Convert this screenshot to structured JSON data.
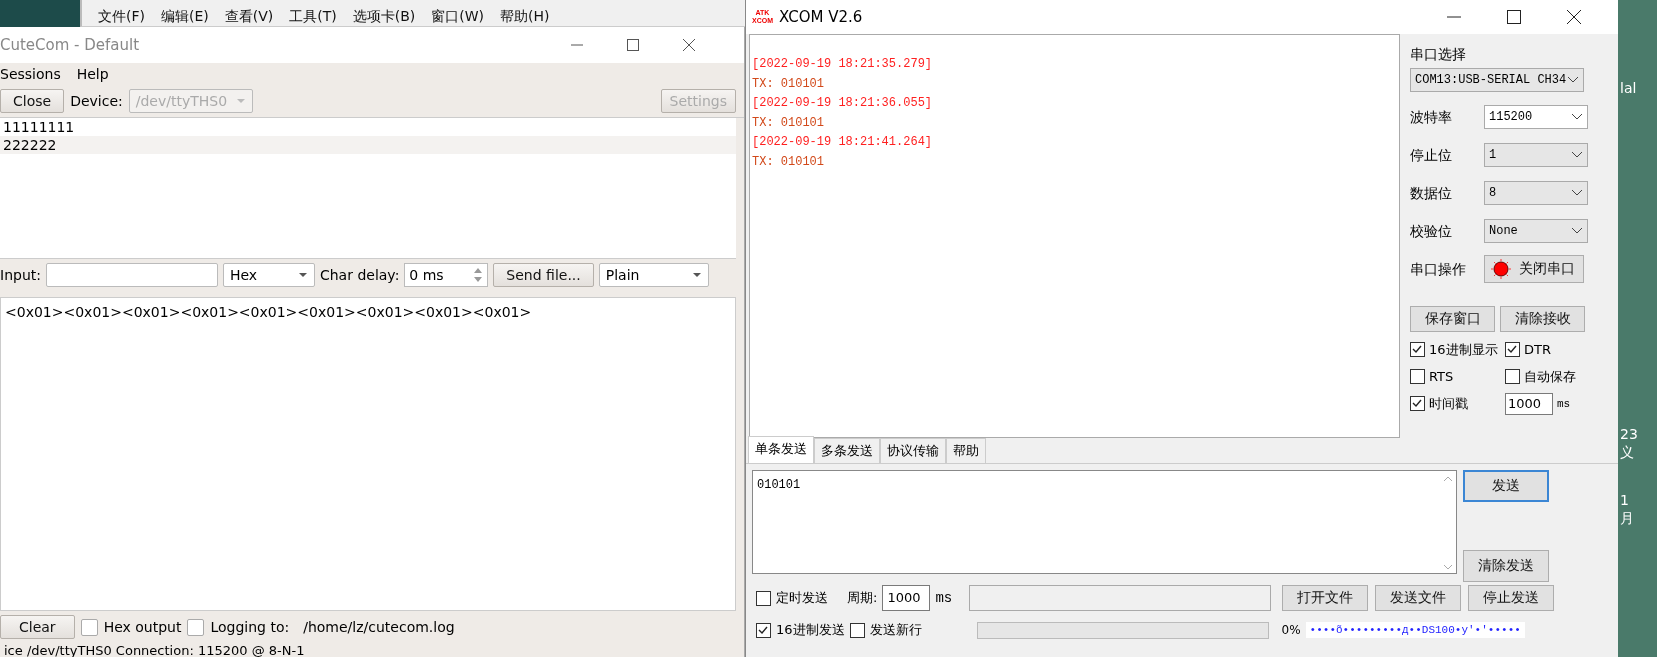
{
  "background_window": {
    "menu": [
      "文件(F)",
      "编辑(E)",
      "查看(V)",
      "工具(T)",
      "选项卡(B)",
      "窗口(W)",
      "帮助(H)"
    ]
  },
  "cutecom": {
    "title": "CuteCom - Default",
    "menu": [
      "Sessions",
      "Help"
    ],
    "close_button": "Close",
    "device_label": "Device:",
    "device": {
      "value": "/dev/ttyTHS0",
      "disabled": true
    },
    "settings_button": {
      "label": "Settings",
      "disabled": true
    },
    "history": [
      "11111111",
      "222222"
    ],
    "input_label": "Input:",
    "input_format": "Hex",
    "char_delay_label": "Char delay:",
    "char_delay": "0 ms",
    "send_file_button": "Send file...",
    "line_end": "Plain",
    "output": "<0x01><0x01><0x01><0x01><0x01><0x01><0x01><0x01><0x01>",
    "clear_button": "Clear",
    "hex_output": {
      "label": "Hex output",
      "checked": false
    },
    "logging": {
      "label": "Logging to:",
      "checked": false
    },
    "log_path": "/home/lz/cutecom.log",
    "status_bar": "ice /dev/ttyTHS0  Connection: 115200 @ 8-N-1"
  },
  "xcom": {
    "logo": [
      "ATK",
      "XCOM"
    ],
    "title": "XCOM V2.6",
    "receive": [
      {
        "kind": "timestamp",
        "text": "[2022-09-19 18:21:35.279]"
      },
      {
        "kind": "tx",
        "text": "TX: 010101"
      },
      {
        "kind": "timestamp",
        "text": "[2022-09-19 18:21:36.055]"
      },
      {
        "kind": "tx",
        "text": "TX: 010101"
      },
      {
        "kind": "timestamp",
        "text": "[2022-09-19 18:21:41.264]"
      },
      {
        "kind": "tx",
        "text": "TX: 010101"
      }
    ],
    "port_label": "串口选择",
    "port": "COM13:USB-SERIAL CH34",
    "settings": [
      {
        "label": "波特率",
        "value": "115200"
      },
      {
        "label": "停止位",
        "value": "1"
      },
      {
        "label": "数据位",
        "value": "8"
      },
      {
        "label": "校验位",
        "value": "None"
      }
    ],
    "operation_label": "串口操作",
    "operation_button": {
      "label": "关闭串口",
      "open": true
    },
    "save_window_button": "保存窗口",
    "clear_receive_button": "清除接收",
    "options": [
      {
        "label": "16进制显示",
        "checked": true
      },
      {
        "label": "DTR",
        "checked": true
      },
      {
        "label": "RTS",
        "checked": false
      },
      {
        "label": "自动保存",
        "checked": false
      },
      {
        "label": "时间戳",
        "checked": true
      }
    ],
    "timestamp_interval": "1000",
    "timestamp_unit": "ms",
    "tabs": [
      {
        "label": "单条发送",
        "selected": true
      },
      {
        "label": "多条发送",
        "selected": false
      },
      {
        "label": "协议传输",
        "selected": false
      },
      {
        "label": "帮助",
        "selected": false
      }
    ],
    "send_text": "010101",
    "send_button": "发送",
    "clear_send_button": "清除发送",
    "timed_send": {
      "label": "定时发送",
      "checked": false
    },
    "period_label": "周期:",
    "period": "1000",
    "period_unit": "ms",
    "open_file_button": "打开文件",
    "send_file_button": "发送文件",
    "stop_send_button": "停止发送",
    "hex_send": {
      "label": "16进制发送",
      "checked": true
    },
    "send_newline": {
      "label": "发送新行",
      "checked": false
    },
    "progress": {
      "level": 0
    },
    "progress_text": "0%",
    "ticker": "••••õ•••••••••д••DS100•y'•'•••••"
  },
  "desktop_edge": [
    "lal",
    "23",
    "义",
    "1",
    "月"
  ]
}
